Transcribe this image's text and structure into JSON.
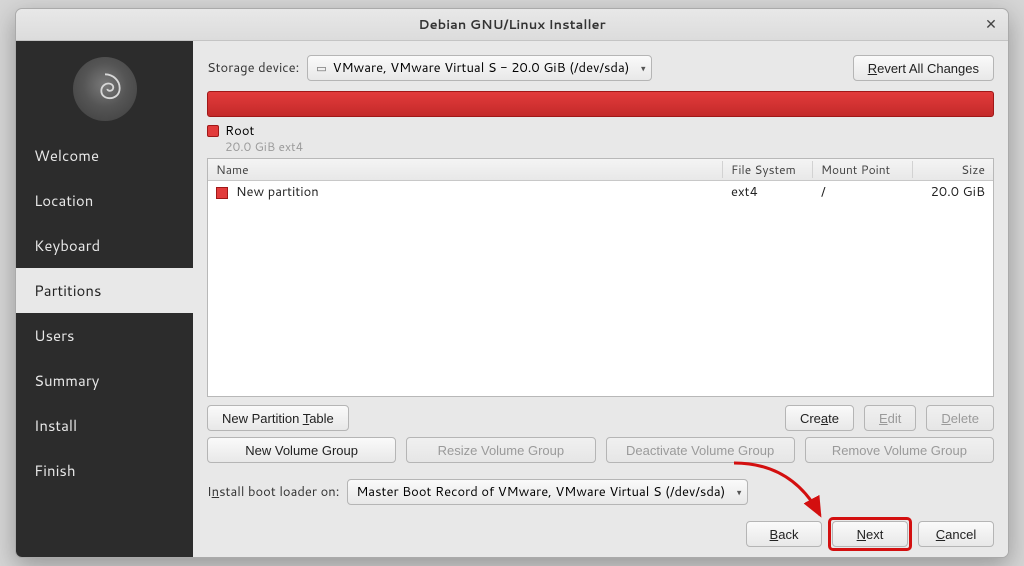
{
  "window": {
    "title": "Debian GNU/Linux Installer",
    "close_glyph": "✕"
  },
  "sidebar": {
    "items": [
      {
        "label": "Welcome"
      },
      {
        "label": "Location"
      },
      {
        "label": "Keyboard"
      },
      {
        "label": "Partitions",
        "active": true
      },
      {
        "label": "Users"
      },
      {
        "label": "Summary"
      },
      {
        "label": "Install"
      },
      {
        "label": "Finish"
      }
    ]
  },
  "storage": {
    "label": "Storage device:",
    "device": "VMware, VMware Virtual S - 20.0 GiB (/dev/sda)",
    "revert": "Revert All Changes",
    "revert_mn": "R"
  },
  "root": {
    "name": "Root",
    "detail": "20.0 GiB  ext4"
  },
  "table": {
    "headers": {
      "name": "Name",
      "fs": "File System",
      "mp": "Mount Point",
      "size": "Size"
    },
    "rows": [
      {
        "name": "New partition",
        "fs": "ext4",
        "mp": "/",
        "size": "20.0 GiB"
      }
    ]
  },
  "buttons": {
    "new_partition_table": "New Partition Table",
    "new_partition_table_mn": "T",
    "create": "Create",
    "create_mn": "a",
    "edit": "Edit",
    "edit_mn": "E",
    "delete": "Delete",
    "delete_mn": "D",
    "new_vg": "New Volume Group",
    "resize_vg": "Resize Volume Group",
    "deact_vg": "Deactivate Volume Group",
    "remove_vg": "Remove Volume Group"
  },
  "bootloader": {
    "label": "Install boot loader on:",
    "label_mn": "n",
    "value": "Master Boot Record of VMware, VMware Virtual S (/dev/sda)"
  },
  "nav": {
    "back": "Back",
    "back_mn": "B",
    "next": "Next",
    "next_mn": "N",
    "cancel": "Cancel",
    "cancel_mn": "C"
  }
}
